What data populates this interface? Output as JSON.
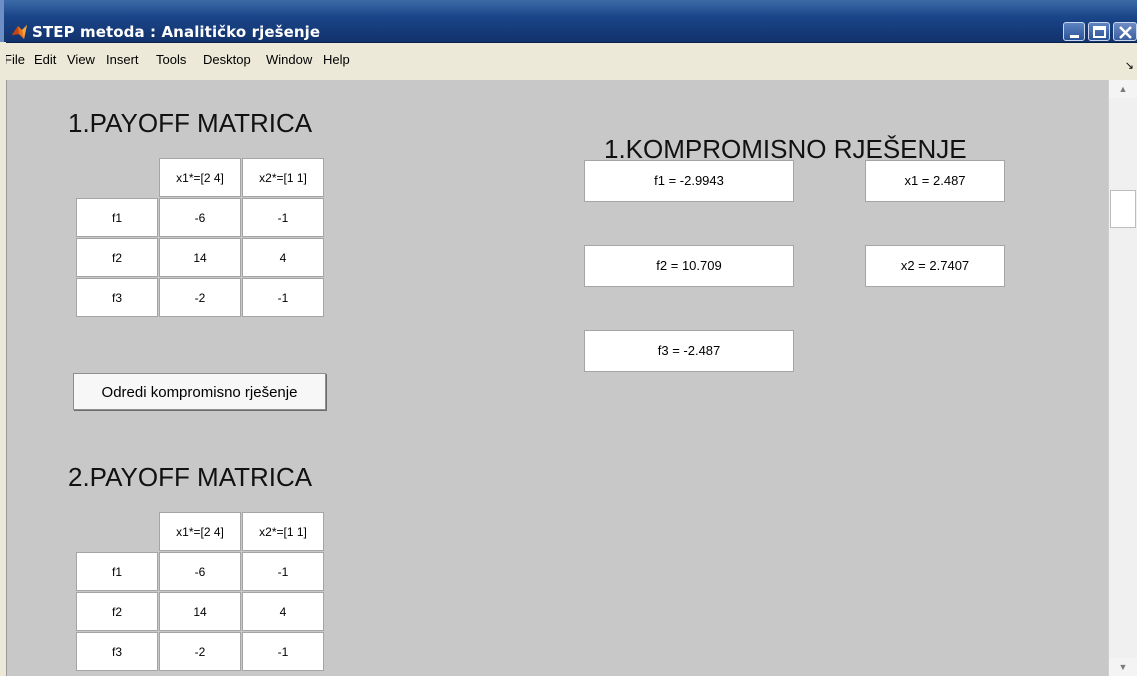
{
  "window": {
    "title": "STEP metoda : Analitičko rješenje",
    "controls": {
      "minimize": "minimize-icon",
      "maximize": "maximize-icon",
      "close": "close-icon"
    }
  },
  "menu": [
    "File",
    "Edit",
    "View",
    "Insert",
    "Tools",
    "Desktop",
    "Window",
    "Help"
  ],
  "payoff1": {
    "title": "1.PAYOFF MATRICA",
    "columns": [
      "x1*=[2  4]",
      "x2*=[1  1]"
    ],
    "rows": [
      {
        "label": "f1",
        "values": [
          "-6",
          "-1"
        ]
      },
      {
        "label": "f2",
        "values": [
          "14",
          "4"
        ]
      },
      {
        "label": "f3",
        "values": [
          "-2",
          "-1"
        ]
      }
    ]
  },
  "compute_button": "Odredi kompromisno rješenje",
  "payoff2": {
    "title": "2.PAYOFF MATRICA",
    "columns": [
      "x1*=[2  4]",
      "x2*=[1  1]"
    ],
    "rows": [
      {
        "label": "f1",
        "values": [
          "-6",
          "-1"
        ]
      },
      {
        "label": "f2",
        "values": [
          "14",
          "4"
        ]
      },
      {
        "label": "f3",
        "values": [
          "-2",
          "-1"
        ]
      }
    ]
  },
  "compromise": {
    "title": "1.KOMPROMISNO RJEŠENJE",
    "f1": "f1 = -2.9943",
    "f2": "f2 = 10.709",
    "f3": "f3 = -2.487",
    "x1": "x1 = 2.487",
    "x2": "x2 = 2.7407"
  }
}
